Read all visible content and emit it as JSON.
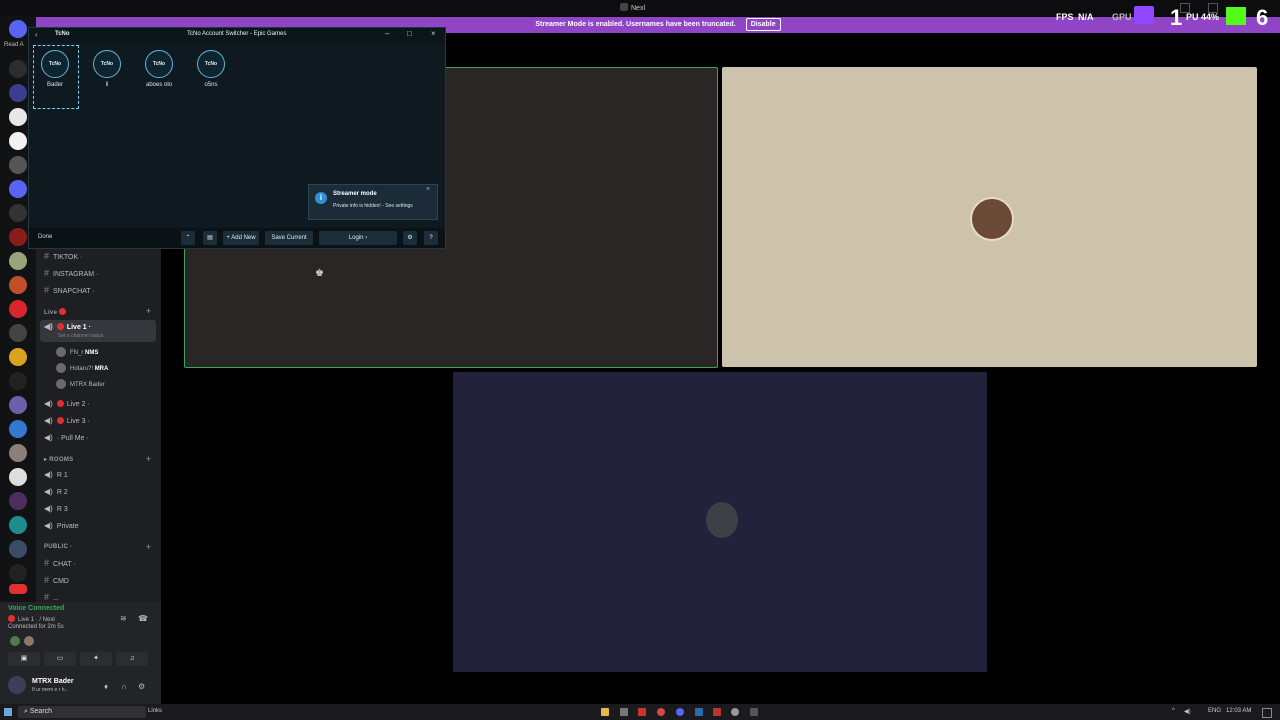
{
  "app_title": "Nexl",
  "banner": {
    "text": "Streamer Mode is enabled. Usernames have been truncated.",
    "button": "Disable"
  },
  "overlay": {
    "fps_label": "FPS",
    "fps_value": "N/A",
    "gpu_label": "GPU",
    "stat_a": "1",
    "cpu_text": "PU 44%",
    "stat_b": "6"
  },
  "rail_text": "Read A",
  "switcher": {
    "logo": "TcNo",
    "title": "TcNo Account Switcher - Epic Games",
    "accounts": [
      {
        "badge": "TcNo",
        "name": "Bader"
      },
      {
        "badge": "TcNo",
        "name": "ll"
      },
      {
        "badge": "TcNo",
        "name": "aboes olo"
      },
      {
        "badge": "TcNo",
        "name": "o5ns"
      }
    ],
    "status": "Done",
    "buttons": {
      "add_new": "+ Add New",
      "save_current": "Save Current",
      "login": "Login ›",
      "help": "?"
    },
    "toast": {
      "title": "Streamer mode",
      "body": "Private info is hidden! - See settings",
      "close": "×"
    }
  },
  "channels": {
    "top": [
      {
        "name": "TIKTOK ·"
      },
      {
        "name": "INSTAGRAM ·"
      },
      {
        "name": "SNAPCHAT ·"
      }
    ],
    "live_category": "Live",
    "live1": "Live 1 ·",
    "live1_status": "Set a channel status",
    "members": [
      {
        "name": "FN_r",
        "tag": "NMS"
      },
      {
        "name": "Hotaru?!",
        "tag": "MRA"
      },
      {
        "name": "MTRX Bader",
        "tag": ""
      }
    ],
    "live_more": [
      "Live 2 ·",
      "Live 3 ·"
    ],
    "pull": "· Pull Me ·",
    "rooms_category": "ROOMS",
    "rooms": [
      "R 1",
      "R 2",
      "R 3",
      "Private"
    ],
    "public_category": "PUBLIC ·",
    "public": [
      "CHAT ·",
      "CMD",
      "..."
    ]
  },
  "voice": {
    "status": "Voice Connected",
    "channel": "Live 1 · / Nexl",
    "duration": "Connected for 2m 5s",
    "user": "MTRX Bader",
    "user_status": "If ur mem e r h..."
  },
  "taskbar": {
    "search": "Search",
    "links": "Links",
    "lang": "ENG",
    "time": "12:03 AM"
  },
  "colors": {
    "banner": "#9045c7",
    "tile_dark": "#2a2626",
    "tile_beige": "#cdc2ab",
    "tile_navy": "#22223a",
    "speaking_border": "#3ba55c"
  }
}
